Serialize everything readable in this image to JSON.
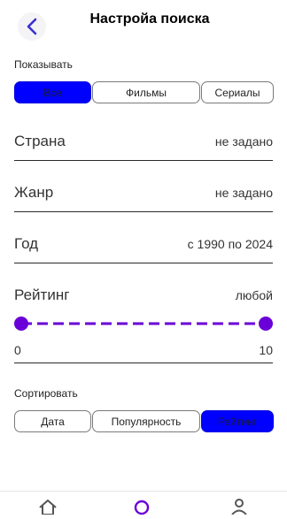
{
  "header": {
    "title": "Настройа поиска"
  },
  "show": {
    "label": "Показывать",
    "options": [
      "Все",
      "Фильмы",
      "Сериалы"
    ],
    "selected": "Все"
  },
  "filters": {
    "country": {
      "label": "Страна",
      "value": "не задано"
    },
    "genre": {
      "label": "Жанр",
      "value": "не задано"
    },
    "year": {
      "label": "Год",
      "value": "с 1990 по 2024"
    },
    "rating": {
      "label": "Рейтинг",
      "value": "любой",
      "min": "0",
      "max": "10"
    }
  },
  "sort": {
    "label": "Сортировать",
    "options": [
      "Дата",
      "Популярность",
      "Рейтинг"
    ],
    "selected": "Рейтинг"
  },
  "nav": {
    "items": [
      "home-icon",
      "search-icon",
      "profile-icon"
    ],
    "active": "search-icon"
  },
  "colors": {
    "accent_blue": "#0000ff",
    "slider_purple": "#6a00d8"
  }
}
